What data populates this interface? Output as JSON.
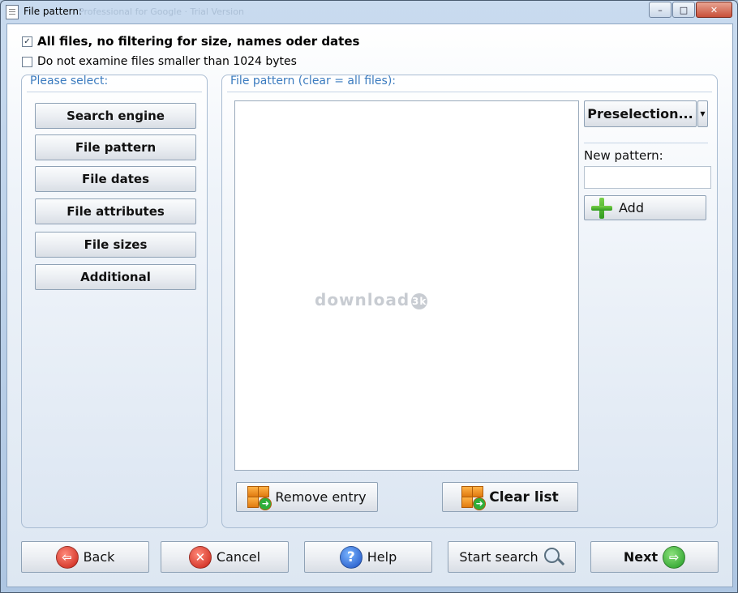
{
  "window": {
    "title": "File pattern:",
    "faded_title": "Professional for Google · Trial Version",
    "minimize": "–",
    "maximize": "□",
    "close": "✕"
  },
  "options": {
    "all_files_checked": true,
    "all_files_label": "All files, no filtering for size, names oder dates",
    "min_size_checked": false,
    "min_size_label": "Do not examine files smaller than 1024 bytes"
  },
  "left_panel": {
    "legend": "Please select:",
    "buttons": [
      "Search engine",
      "File pattern",
      "File dates",
      "File attributes",
      "File sizes",
      "Additional"
    ]
  },
  "right_panel": {
    "legend": "File pattern (clear = all files):",
    "watermark": "download",
    "watermark_badge": "3k",
    "preselection_label": "Preselection...",
    "preselection_arrow": "▼",
    "new_pattern_label": "New pattern:",
    "new_pattern_value": "",
    "add_label": "Add",
    "remove_label": "Remove entry",
    "clear_label": "Clear list"
  },
  "bottom": {
    "back": "Back",
    "back_glyph": "⇦",
    "cancel": "Cancel",
    "cancel_glyph": "✕",
    "help": "Help",
    "help_glyph": "?",
    "start_search": "Start search",
    "next": "Next",
    "next_glyph": "⇨"
  },
  "colors": {
    "accent_legend": "#3b7bbf",
    "window_frame": "#4a5b70",
    "close_button": "#c8503a"
  }
}
